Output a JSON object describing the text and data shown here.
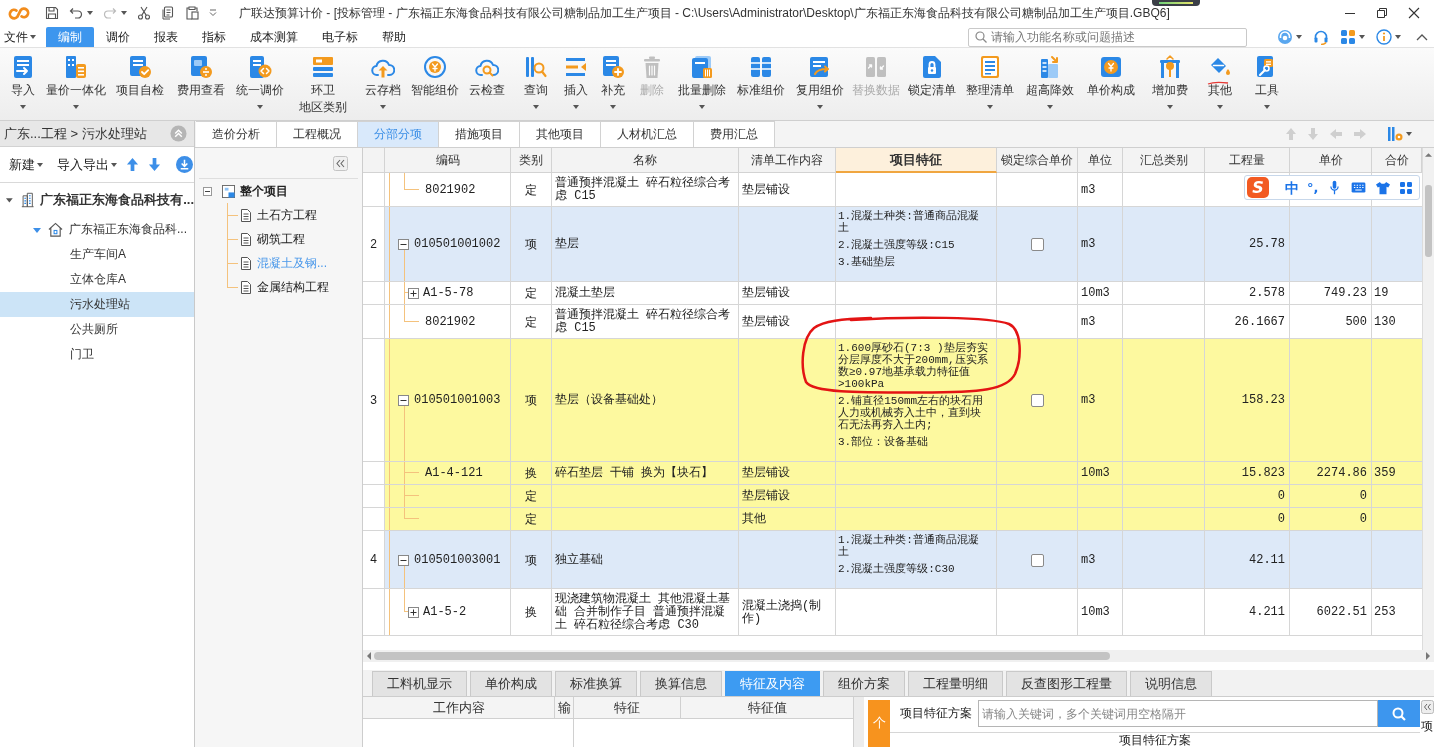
{
  "window": {
    "title": "广联达预算计价 - [投标管理 - 广东福正东海食品科技有限公司糖制品加工生产项目 - C:\\Users\\Administrator\\Desktop\\广东福正东海食品科技有限公司糖制品加工生产项目.GBQ6]"
  },
  "menu": [
    {
      "label": "文件",
      "dropdown": true,
      "selected": false
    },
    {
      "label": "编制",
      "dropdown": false,
      "selected": true
    },
    {
      "label": "调价",
      "dropdown": false,
      "selected": false
    },
    {
      "label": "报表",
      "dropdown": false,
      "selected": false
    },
    {
      "label": "指标",
      "dropdown": false,
      "selected": false
    },
    {
      "label": "成本测算",
      "dropdown": false,
      "selected": false
    },
    {
      "label": "电子标",
      "dropdown": false,
      "selected": false
    },
    {
      "label": "帮助",
      "dropdown": false,
      "selected": false
    }
  ],
  "search": {
    "placeholder": "请输入功能名称或问题描述"
  },
  "toolbar": [
    {
      "label": "导入",
      "dropdown": true,
      "disabled": false
    },
    {
      "label": "量价一体化",
      "dropdown": true,
      "disabled": false
    },
    {
      "label": "项目自检",
      "dropdown": false,
      "disabled": false
    },
    {
      "label": "费用查看",
      "dropdown": false,
      "disabled": false
    },
    {
      "label": "统一调价",
      "dropdown": true,
      "disabled": false
    },
    {
      "label": "环卫",
      "second_line": "地区类别",
      "dropdown": false,
      "disabled": false
    },
    {
      "label": "云存档",
      "dropdown": true,
      "disabled": false
    },
    {
      "label": "智能组价",
      "dropdown": false,
      "disabled": false
    },
    {
      "label": "云检查",
      "dropdown": false,
      "disabled": false
    },
    {
      "label": "查询",
      "dropdown": true,
      "disabled": false
    },
    {
      "label": "插入",
      "dropdown": true,
      "disabled": false
    },
    {
      "label": "补充",
      "dropdown": true,
      "disabled": false
    },
    {
      "label": "删除",
      "dropdown": false,
      "disabled": true
    },
    {
      "label": "批量删除",
      "dropdown": true,
      "disabled": false
    },
    {
      "label": "标准组价",
      "dropdown": false,
      "disabled": false
    },
    {
      "label": "复用组价",
      "dropdown": true,
      "disabled": false
    },
    {
      "label": "替换数据",
      "dropdown": false,
      "disabled": true
    },
    {
      "label": "锁定清单",
      "dropdown": false,
      "disabled": false
    },
    {
      "label": "整理清单",
      "dropdown": true,
      "disabled": false
    },
    {
      "label": "超高降效",
      "dropdown": true,
      "disabled": false
    },
    {
      "label": "单价构成",
      "dropdown": false,
      "disabled": false
    },
    {
      "label": "增加费",
      "dropdown": true,
      "disabled": false
    },
    {
      "label": "其他",
      "dropdown": true,
      "disabled": false
    },
    {
      "label": "工具",
      "dropdown": true,
      "disabled": false
    }
  ],
  "breadcrumb": "广东...工程 > 污水处理站",
  "project_actions": [
    {
      "label": "新建",
      "dropdown": true
    },
    {
      "label": "导入导出",
      "dropdown": true
    }
  ],
  "project_tree": [
    {
      "label": "广东福正东海食品科技有...",
      "expanded": true,
      "selected": false,
      "children": [
        {
          "label": "广东福正东海食品科...",
          "expanded": true,
          "selected": false,
          "children": [
            {
              "label": "生产车间A",
              "selected": false
            },
            {
              "label": "立体仓库A",
              "selected": false
            },
            {
              "label": "污水处理站",
              "selected": true
            },
            {
              "label": "公共厕所",
              "selected": false
            },
            {
              "label": "门卫",
              "selected": false
            }
          ]
        }
      ]
    }
  ],
  "section_tree": [
    {
      "label": "整个项目",
      "expanded": true,
      "selected": false,
      "children": [
        {
          "label": "土石方工程",
          "selected": false
        },
        {
          "label": "砌筑工程",
          "selected": false
        },
        {
          "label": "混凝土及钢...",
          "selected": true
        },
        {
          "label": "金属结构工程",
          "selected": false
        }
      ]
    }
  ],
  "tabs": [
    {
      "label": "造价分析",
      "selected": false
    },
    {
      "label": "工程概况",
      "selected": false
    },
    {
      "label": "分部分项",
      "selected": true
    },
    {
      "label": "措施项目",
      "selected": false
    },
    {
      "label": "其他项目",
      "selected": false
    },
    {
      "label": "人材机汇总",
      "selected": false
    },
    {
      "label": "费用汇总",
      "selected": false
    }
  ],
  "table": {
    "columns": [
      {
        "label": "编码",
        "selected": false
      },
      {
        "label": "类别",
        "selected": false
      },
      {
        "label": "名称",
        "selected": false
      },
      {
        "label": "清单工作内容",
        "selected": false
      },
      {
        "label": "项目特征",
        "selected": true
      },
      {
        "label": "锁定综合单价",
        "selected": false
      },
      {
        "label": "单位",
        "selected": false
      },
      {
        "label": "汇总类别",
        "selected": false
      },
      {
        "label": "工程量",
        "selected": false
      },
      {
        "label": "单价",
        "selected": false
      },
      {
        "label": "合价",
        "selected": false
      }
    ],
    "rows": [
      {
        "kind": "sub",
        "code": "8021902",
        "type": "定",
        "name": "普通预拌混凝土 碎石粒径综合考虑 C15",
        "work": "垫层铺设",
        "unit": "m3",
        "selected": false
      },
      {
        "kind": "item",
        "number": "2",
        "code": "010501001002",
        "expanded": true,
        "type": "项",
        "name": "垫层",
        "features": "1.混凝土种类:普通商品混凝土\n2.混凝土强度等级:C15\n3.基础垫层",
        "locked": false,
        "unit": "m3",
        "quantity": "25.78",
        "selected": false,
        "children": [
          {
            "kind": "sub",
            "code": "A1-5-78",
            "expanded": false,
            "type": "定",
            "name": "混凝土垫层",
            "work": "垫层铺设",
            "unit": "10m3",
            "quantity": "2.578",
            "unit_price": "749.23",
            "total": "19",
            "selected": false
          },
          {
            "kind": "sub",
            "code": "8021902",
            "type": "定",
            "name": "普通预拌混凝土 碎石粒径综合考虑 C15",
            "work": "垫层铺设",
            "unit": "m3",
            "quantity": "26.1667",
            "unit_price": "500",
            "total": "130",
            "selected": false
          }
        ]
      },
      {
        "kind": "item",
        "number": "3",
        "code": "010501001003",
        "expanded": true,
        "type": "项",
        "name": "垫层（设备基础处）",
        "features": "1.600厚砂石(7:3 )垫层夯实分层厚度不大于200mm,压实系数≥0.97地基承载力特征值>100kPa\n2.铺直径150mm左右的块石用人力或机械夯入土中，直到块石无法再夯入土内;\n3.部位：设备基础",
        "locked": false,
        "unit": "m3",
        "quantity": "158.23",
        "selected": true,
        "children": [
          {
            "kind": "sub",
            "code": "A1-4-121",
            "type": "换",
            "name": "碎石垫层 干铺 换为【块石】",
            "work": "垫层铺设",
            "unit": "10m3",
            "quantity": "15.823",
            "unit_price": "2274.86",
            "total": "359",
            "selected": true
          },
          {
            "kind": "sub",
            "type": "定",
            "work": "垫层铺设",
            "quantity": "0",
            "unit_price": "0",
            "selected": true
          },
          {
            "kind": "sub",
            "type": "定",
            "work": "其他",
            "quantity": "0",
            "unit_price": "0",
            "selected": true
          }
        ]
      },
      {
        "kind": "item",
        "number": "4",
        "code": "010501003001",
        "expanded": true,
        "type": "项",
        "name": "独立基础",
        "features": "1.混凝土种类:普通商品混凝土\n2.混凝土强度等级:C30",
        "locked": false,
        "unit": "m3",
        "quantity": "42.11",
        "selected": false,
        "children": [
          {
            "kind": "sub",
            "code": "A1-5-2",
            "expanded": false,
            "type": "换",
            "name": "现浇建筑物混凝土 其他混凝土基础 合并制作子目 普通预拌混凝土 碎石粒径综合考虑 C30",
            "work": "混凝土浇捣(制作)",
            "unit": "10m3",
            "quantity": "4.211",
            "unit_price": "6022.51",
            "total": "253",
            "selected": false
          }
        ]
      }
    ]
  },
  "ime_bar": {
    "logo": "S",
    "mode": "中",
    "punctuation": "°,"
  },
  "bottom_tabs": [
    {
      "label": "工料机显示",
      "selected": false
    },
    {
      "label": "单价构成",
      "selected": false
    },
    {
      "label": "标准换算",
      "selected": false
    },
    {
      "label": "换算信息",
      "selected": false
    },
    {
      "label": "特征及内容",
      "selected": true
    },
    {
      "label": "组价方案",
      "selected": false
    },
    {
      "label": "工程量明细",
      "selected": false
    },
    {
      "label": "反查图形工程量",
      "selected": false
    },
    {
      "label": "说明信息",
      "selected": false
    }
  ],
  "work_grid": {
    "columns": [
      "工作内容",
      "输"
    ]
  },
  "feature_grid": {
    "columns": [
      "特征",
      "特征值"
    ]
  },
  "feature_scheme": {
    "side_tab": "个",
    "label": "项目特征方案",
    "placeholder": "请输入关键词，多个关键词用空格隔开",
    "header": "项目特征方案",
    "side_label": "项"
  }
}
